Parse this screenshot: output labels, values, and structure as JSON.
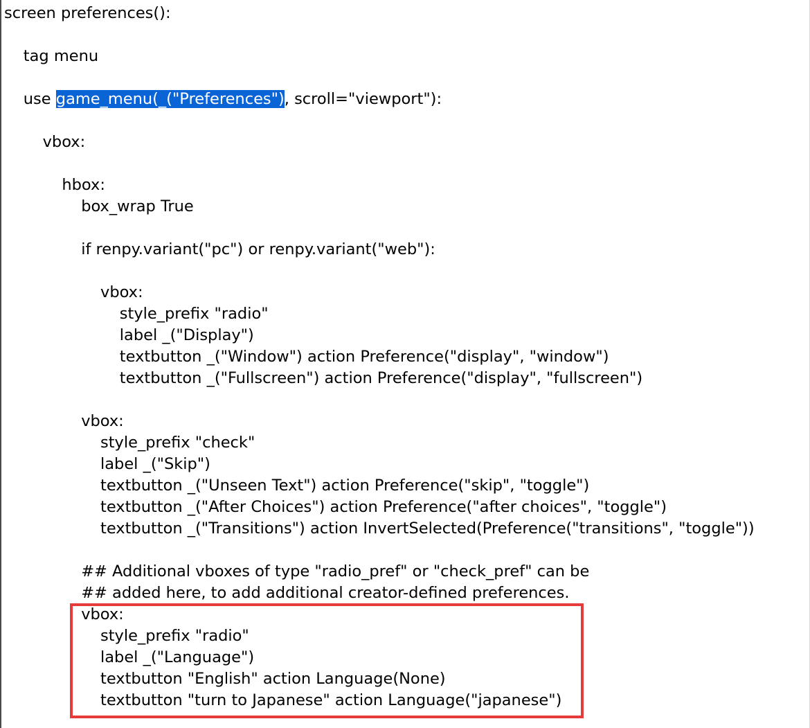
{
  "code_lines": [
    {
      "indent": 0,
      "text": "screen preferences():"
    },
    {
      "indent": 0,
      "text": ""
    },
    {
      "indent": 1,
      "text": "tag menu"
    },
    {
      "indent": 0,
      "text": ""
    },
    {
      "indent": 1,
      "pre": "use ",
      "selected": "game_menu(_(\"Preferences\")",
      "post": ", scroll=\"viewport\"):"
    },
    {
      "indent": 0,
      "text": ""
    },
    {
      "indent": 2,
      "text": "vbox:"
    },
    {
      "indent": 0,
      "text": ""
    },
    {
      "indent": 3,
      "text": "hbox:"
    },
    {
      "indent": 4,
      "text": "box_wrap True"
    },
    {
      "indent": 0,
      "text": ""
    },
    {
      "indent": 4,
      "text": "if renpy.variant(\"pc\") or renpy.variant(\"web\"):"
    },
    {
      "indent": 0,
      "text": ""
    },
    {
      "indent": 5,
      "text": "vbox:"
    },
    {
      "indent": 6,
      "text": "style_prefix \"radio\""
    },
    {
      "indent": 6,
      "text": "label _(\"Display\")"
    },
    {
      "indent": 6,
      "text": "textbutton _(\"Window\") action Preference(\"display\", \"window\")"
    },
    {
      "indent": 6,
      "text": "textbutton _(\"Fullscreen\") action Preference(\"display\", \"fullscreen\")"
    },
    {
      "indent": 0,
      "text": ""
    },
    {
      "indent": 4,
      "text": "vbox:"
    },
    {
      "indent": 5,
      "text": "style_prefix \"check\""
    },
    {
      "indent": 5,
      "text": "label _(\"Skip\")"
    },
    {
      "indent": 5,
      "text": "textbutton _(\"Unseen Text\") action Preference(\"skip\", \"toggle\")"
    },
    {
      "indent": 5,
      "text": "textbutton _(\"After Choices\") action Preference(\"after choices\", \"toggle\")"
    },
    {
      "indent": 5,
      "text": "textbutton _(\"Transitions\") action InvertSelected(Preference(\"transitions\", \"toggle\"))"
    },
    {
      "indent": 0,
      "text": ""
    },
    {
      "indent": 4,
      "text": "## Additional vboxes of type \"radio_pref\" or \"check_pref\" can be"
    },
    {
      "indent": 4,
      "text": "## added here, to add additional creator-defined preferences."
    },
    {
      "indent": 4,
      "text": "vbox:"
    },
    {
      "indent": 5,
      "text": "style_prefix \"radio\""
    },
    {
      "indent": 5,
      "text": "label _(\"Language\")"
    },
    {
      "indent": 5,
      "text": "textbutton \"English\" action Language(None)"
    },
    {
      "indent": 5,
      "text": "textbutton \"turn to Japanese\" action Language(\"japanese\")"
    }
  ],
  "colors": {
    "selection": "#0a64d6",
    "annotation_box": "#e63b3b",
    "background": "#ffffff",
    "text": "#000000"
  }
}
